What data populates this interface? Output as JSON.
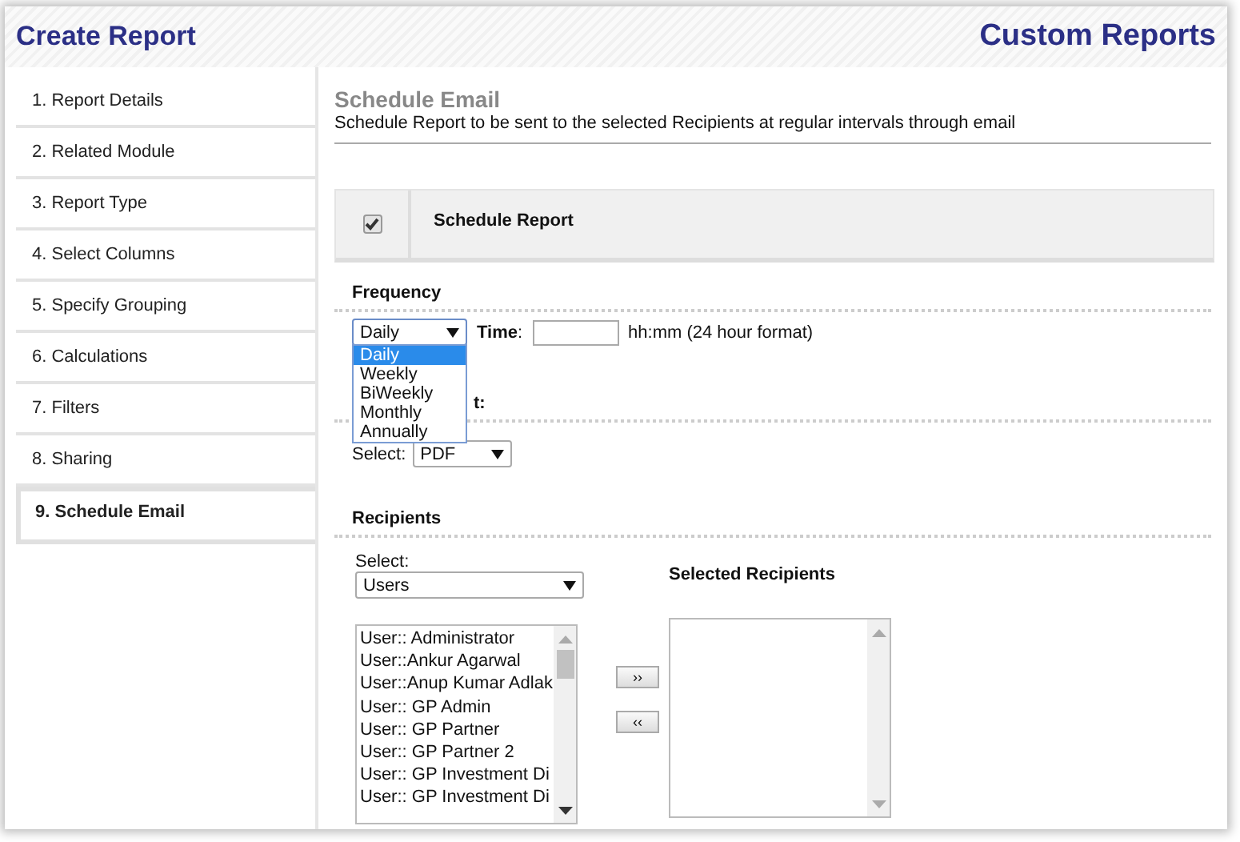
{
  "header": {
    "title": "Create Report",
    "app_title": "Custom Reports"
  },
  "steps": [
    {
      "label": "1. Report Details",
      "selected": false
    },
    {
      "label": "2. Related Module",
      "selected": false
    },
    {
      "label": "3. Report Type",
      "selected": false
    },
    {
      "label": "4. Select Columns",
      "selected": false
    },
    {
      "label": "5. Specify Grouping",
      "selected": false
    },
    {
      "label": "6. Calculations",
      "selected": false
    },
    {
      "label": "7. Filters",
      "selected": false
    },
    {
      "label": "8. Sharing",
      "selected": false
    },
    {
      "label": "9. Schedule Email",
      "selected": true
    }
  ],
  "page": {
    "title": "Schedule Email",
    "description": "Schedule Report to be sent to the selected Recipients at regular intervals through email"
  },
  "schedule": {
    "label": "Schedule Report",
    "checked": true
  },
  "frequency": {
    "heading": "Frequency",
    "value": "Daily",
    "expanded": true,
    "options": [
      {
        "label": "Daily",
        "selected": true
      },
      {
        "label": "Weekly",
        "selected": false
      },
      {
        "label": "BiWeekly",
        "selected": false
      },
      {
        "label": "Monthly",
        "selected": false
      },
      {
        "label": "Annually",
        "selected": false
      }
    ],
    "time_label": "Time",
    "time_colon": ":",
    "time_hint": "hh:mm (24 hour format)"
  },
  "format": {
    "heading_visible": "t:",
    "select_label": "Select:",
    "value": "PDF"
  },
  "recipients": {
    "heading": "Recipients",
    "select_label": "Select:",
    "value": "Users",
    "selected_heading": "Selected Recipients",
    "available": [
      "User:: Administrator",
      "User::Ankur Agarwal",
      "User::Anup Kumar Adlak",
      "User:: GP Admin",
      "User:: GP Partner",
      "User:: GP Partner 2",
      "User:: GP Investment Di",
      "User:: GP Investment Di"
    ],
    "add_button": "››",
    "remove_button": "‹‹"
  }
}
